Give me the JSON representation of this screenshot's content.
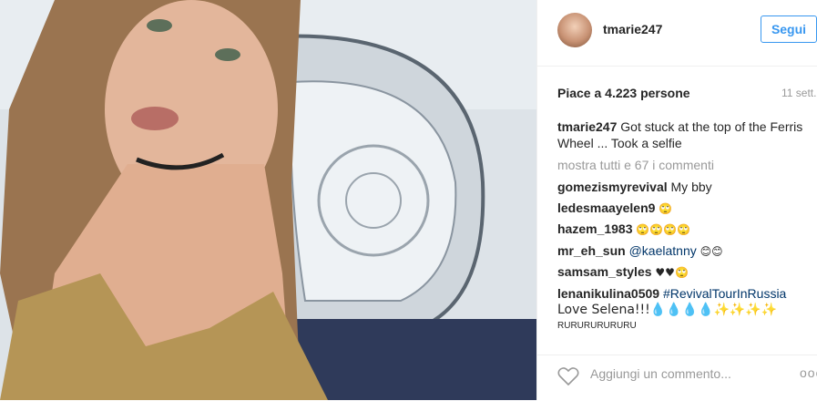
{
  "header": {
    "username": "tmarie247",
    "follow_label": "Segui"
  },
  "post": {
    "likes": "Piace a 4.223 persone",
    "date": "11 sett.",
    "caption_user": "tmarie247",
    "caption_text": "Got stuck at the top of the Ferris Wheel ... Took a selfie",
    "show_all": "mostra tutti e 67 i commenti"
  },
  "comments": [
    {
      "user": "gomezismyrevival",
      "text": "My bby"
    },
    {
      "user": "ledesmaayelen9",
      "text": "🙄"
    },
    {
      "user": "hazem_1983",
      "text": "🙄🙄🙄🙄"
    },
    {
      "user": "mr_eh_sun",
      "mention": "@kaelatnny",
      "text": "😊😊"
    },
    {
      "user": "samsam_styles",
      "text": "♥♥🙄"
    },
    {
      "user": "lenanikulina0509",
      "tag": "#RevivalTourInRussia",
      "text": "Love Selena!!!💧💧💧💧✨✨✨✨",
      "tail": "RURURURURURU"
    }
  ],
  "footer": {
    "comment_placeholder": "Aggiungi un commento...",
    "more_icon": "ooo"
  }
}
